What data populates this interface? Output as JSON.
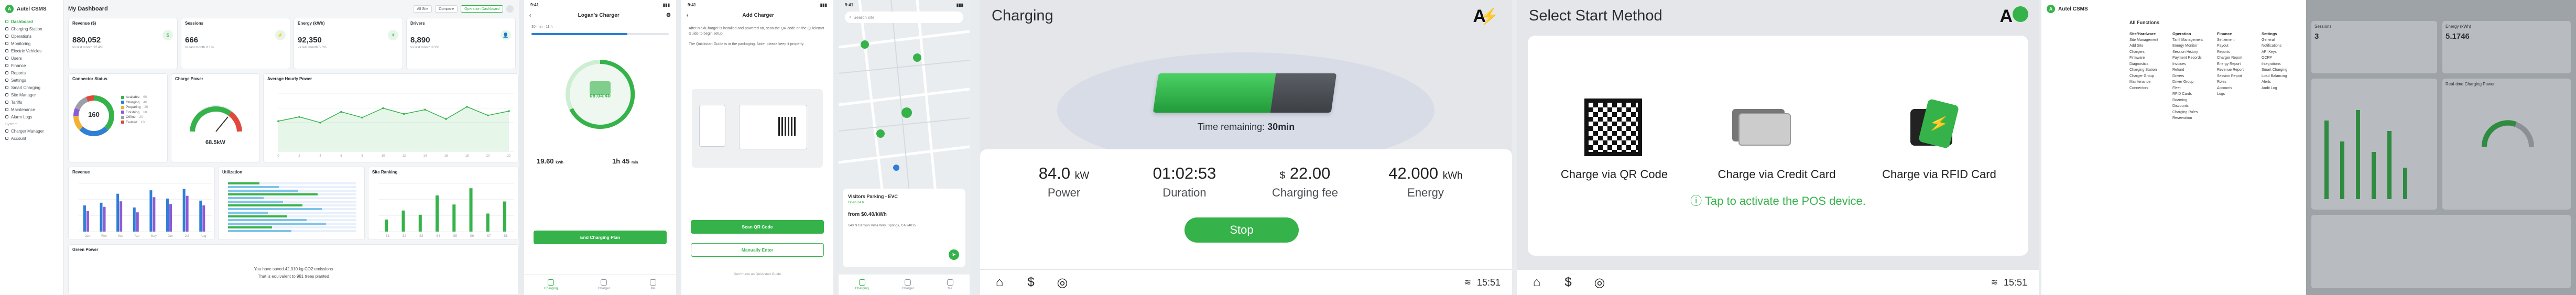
{
  "dashboard": {
    "brand": "Autel CSMS",
    "sidebar": [
      "Dashboard",
      "Charging Station",
      "Operations",
      "Monitoring",
      "Electric Vehicles",
      "Users",
      "Finance",
      "Reports",
      "Settings"
    ],
    "sidebar_more": [
      "Smart Charging",
      "Site Manager",
      "Tariffs",
      "Maintenance",
      "Alarm Logs"
    ],
    "sidebar_group": "System",
    "sidebar_bottom": [
      "Charger Manager",
      "Account"
    ],
    "title": "My Dashboard",
    "filter": "All Site",
    "btn_compare": "Compare",
    "btn_export": "Operation Dashboard",
    "kpis": [
      {
        "label": "Revenue ($)",
        "value": "880,052",
        "sub": "vs last month 12.4%",
        "icon": "$"
      },
      {
        "label": "Sessions",
        "value": "666",
        "sub": "vs last month 8.1%",
        "icon": "⚡"
      },
      {
        "label": "Energy (kWh)",
        "value": "92,350",
        "sub": "vs last month 5.6%",
        "icon": "☀"
      },
      {
        "label": "Drivers",
        "value": "8,890",
        "sub": "vs last month 3.3%",
        "icon": "👤"
      }
    ],
    "connector_status_title": "Connector Status",
    "connector_total": "160",
    "connector_legend": [
      {
        "name": "Available",
        "count": "60",
        "color": "#35b34a"
      },
      {
        "name": "Charging",
        "count": "40",
        "color": "#2f7fd6"
      },
      {
        "name": "Preparing",
        "count": "20",
        "color": "#f2b134"
      },
      {
        "name": "Finishing",
        "count": "10",
        "color": "#8e5bd6"
      },
      {
        "name": "Offline",
        "count": "20",
        "color": "#9aa0a6"
      },
      {
        "name": "Faulted",
        "count": "10",
        "color": "#e0483c"
      }
    ],
    "charge_power_title": "Charge Power",
    "charge_power_value": "68.5kW",
    "power_curve_title": "Average Hourly Power",
    "revenue_title": "Revenue",
    "utilization_title": "Utilization",
    "site_ranking_title": "Site Ranking",
    "green_title": "Green Power",
    "green_line1": "You have saved 42,010 kg CO2 emissions",
    "green_line2": "That is equivalent to 981 trees planted"
  },
  "chart_data": [
    {
      "type": "line",
      "title": "Average Hourly Power",
      "x": [
        "0",
        "2",
        "4",
        "6",
        "8",
        "10",
        "12",
        "14",
        "16",
        "18",
        "20",
        "22"
      ],
      "series": [
        {
          "values": [
            42,
            48,
            40,
            55,
            47,
            60,
            52,
            58,
            45,
            62,
            50,
            56
          ]
        }
      ]
    },
    {
      "type": "bar",
      "title": "Revenue",
      "categories": [
        "Jan",
        "Feb",
        "Mar",
        "Apr",
        "May",
        "Jun",
        "Jul",
        "Aug"
      ],
      "series": [
        {
          "values": [
            38,
            42,
            55,
            35,
            60,
            48,
            62,
            45
          ]
        },
        {
          "values": [
            30,
            36,
            44,
            28,
            50,
            40,
            52,
            38
          ]
        }
      ]
    },
    {
      "type": "bar",
      "title": "Site Ranking",
      "categories": [
        "S1",
        "S2",
        "S3",
        "S4",
        "S5",
        "S6",
        "S7",
        "S8"
      ],
      "series": [
        {
          "values": [
            20,
            35,
            28,
            60,
            45,
            72,
            30,
            50
          ]
        }
      ]
    }
  ],
  "phone1": {
    "time": "9:41",
    "title": "Logan's Charger",
    "limits": "30 min · 11 h",
    "mid": "06:04:40",
    "power": "19.60",
    "power_unit": "kWh",
    "current": "1h 45",
    "current_unit": "min",
    "btn": "End Charging Plan",
    "tabs": [
      "Charging",
      "Charger",
      "Me"
    ]
  },
  "phone2": {
    "time": "9:41",
    "title": "Add Charger",
    "text": "After MaxiCharger is installed and powered on, scan the QR code on the Quickstart Guide to begin setup.",
    "text2": "The Quickstart Guide is in the packaging. Note: please keep it properly.",
    "btn1": "Scan QR Code",
    "btn2": "Manually Enter",
    "foot": "Don't have an Quickstart Guide"
  },
  "phone3": {
    "time": "9:41",
    "search": "Search site",
    "site": "Visitors Parking - EVC",
    "site_sub": "Open 24 h",
    "price": "from $0.40/kWh",
    "addr": "140 N Canyon Vista Way, Springs, CA 94015",
    "tabs": [
      "Charging",
      "Charger",
      "Me"
    ]
  },
  "kiosk1": {
    "title": "Charging",
    "brand": "A",
    "remaining_label": "Time remaining:",
    "remaining_value": "30min",
    "stats": [
      {
        "value": "84.0",
        "unit": "kW",
        "label": "Power"
      },
      {
        "value": "01:02:53",
        "unit": "",
        "label": "Duration"
      },
      {
        "value": "22.00",
        "unit": "$",
        "label": "Charging fee"
      },
      {
        "value": "42.000",
        "unit": "kWh",
        "label": "Energy"
      }
    ],
    "stop": "Stop",
    "clock": "15:51"
  },
  "kiosk2": {
    "title": "Select Start Method",
    "brand": "A",
    "methods": [
      "Charge via QR Code",
      "Charge via Credit Card",
      "Charge via RFID Card"
    ],
    "hint": "Tap to activate the POS device.",
    "clock": "15:51"
  },
  "admin": {
    "brand": "Autel CSMS",
    "menu_title": "All Functions",
    "col1_head": "Site/Hardware",
    "col1": [
      "Site Management",
      "Add Site",
      "Chargers",
      "Firmware",
      "Diagnostics",
      "Charging Station",
      "Charger Group",
      "Maintenance",
      "Connectors"
    ],
    "col2_head": "Operation",
    "col2": [
      "Tariff Management",
      "Energy Monitor",
      "Session History",
      "Payment Records",
      "Invoices",
      "Refund",
      "Drivers",
      "Driver Group",
      "Fleet",
      "RFID Cards",
      "Roaming",
      "Discounts",
      "Charging Rules",
      "Reservation"
    ],
    "col3_head": "Finance",
    "col3": [
      "Settlement",
      "Payout",
      "Reports",
      "Charger Report",
      "Energy Report",
      "Revenue Report",
      "Session Report",
      "Roles",
      "Accounts",
      "Logs"
    ],
    "col4_head": "Settings",
    "col4": [
      "General",
      "Notifications",
      "API Keys",
      "OCPP",
      "Integrations",
      "Smart Charging",
      "Load Balancing",
      "Alerts",
      "Audit Log"
    ],
    "sessions_label": "Sessions",
    "sessions_value": "3",
    "energy_label": "Energy (kWh)",
    "energy_value": "5.1746",
    "right_label": "Real-time Charging Power"
  }
}
